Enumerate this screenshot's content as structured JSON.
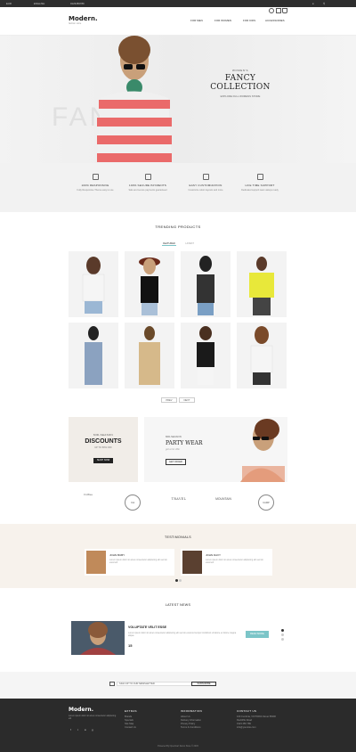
{
  "topbar": {
    "currency": "EUR",
    "language": "ENGLISH",
    "phone": "0123456789"
  },
  "header": {
    "logo": "Modern.",
    "logo_tagline": "fashion store"
  },
  "nav": [
    {
      "label": "FOR MEN"
    },
    {
      "label": "FOR WOMEN"
    },
    {
      "label": "FOR KIDS"
    },
    {
      "label": "ACCESSORIES"
    }
  ],
  "hero": {
    "kicker": "WOMEN'S",
    "title": "FANCY COLLECTION",
    "subtitle": "EXPLORE FULL WOMENS STORE",
    "bg_word": "FANCY"
  },
  "features": [
    {
      "title": "100% RESPONSIVE",
      "desc": "Fully Responsive Theme easy to use"
    },
    {
      "title": "100% SECURE PAYMENTS",
      "desc": "Safe and secure payments guaranteed"
    },
    {
      "title": "EASY CUSTOMIZATION",
      "desc": "Customize colors layouts and more"
    },
    {
      "title": "LIFE TIME SUPPORT",
      "desc": "Dedicated support team always ready"
    }
  ],
  "trending": {
    "title": "TRENDING PRODUCTS",
    "tabs": [
      "FEATURED",
      "LATEST"
    ],
    "prev": "PREV",
    "next": "NEXT"
  },
  "banners": {
    "left": {
      "kicker": "MID-SEASON",
      "title": "DISCOUNTS",
      "sub": "UP TO 50% OFF",
      "button": "SHOP NOW"
    },
    "right": {
      "kicker": "MID-SEASON",
      "title": "PARTY WEAR",
      "sub": "get a hot offer",
      "button": "GET OFFER"
    }
  },
  "brands": [
    "Coffee",
    "Yeti",
    "TRAVEL",
    "MOUNTAIN",
    "CAMP"
  ],
  "testimonials": {
    "title": "TESTIMONIALS",
    "items": [
      {
        "name": "JOHN BUBY",
        "text": "Lorem ipsum dolor sit amet consectetur adipiscing elit sed do eiusmod"
      },
      {
        "name": "JOHN DAVY",
        "text": "Lorem ipsum dolor sit amet consectetur adipiscing elit sed do eiusmod"
      }
    ]
  },
  "news": {
    "title": "LATEST NEWS",
    "post_title": "VOLUPTATE VELIT ESSE",
    "post_text": "Lorem ipsum dolor sit amet consectetur adipiscing elit sed do eiusmod tempor incididunt ut labore et dolore magna aliqua.",
    "date": "15",
    "button": "READ MORE"
  },
  "newsletter": {
    "label": "SIGN UP TO OUR NEWSLETTER",
    "button": "SUBSCRIBE"
  },
  "footer": {
    "logo": "Modern.",
    "about": "Lorem ipsum dolor sit amet consectetur adipiscing elit",
    "extras": {
      "title": "EXTRAS",
      "items": [
        "Brands",
        "Specials",
        "Site Map",
        "Contact Us"
      ]
    },
    "information": {
      "title": "INFORMATION",
      "items": [
        "About Us",
        "Delivery Information",
        "Privacy Policy",
        "Terms & Conditions"
      ]
    },
    "contact": {
      "title": "CONTACT US",
      "items": [
        "100 Cumbria, VICTORIA Street 58290",
        "Redcliffe Road",
        "0123 456 789",
        "info@yoursite.com"
      ]
    },
    "copyright": "Powered By OpenCart Demo Store © 2015"
  },
  "colors": {
    "accent": "#7cc5c8",
    "dark": "#2b2b2b"
  }
}
